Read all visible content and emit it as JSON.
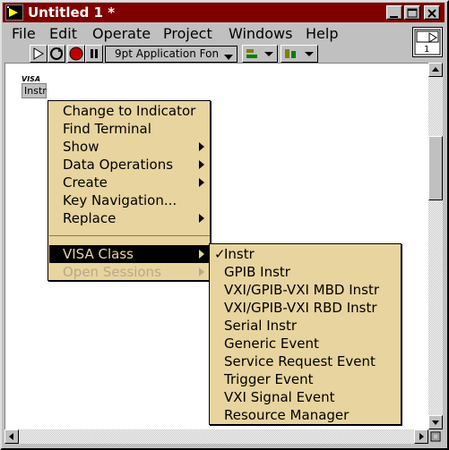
{
  "window": {
    "title": "Untitled 1 *"
  },
  "menubar": {
    "items": [
      {
        "label": "File"
      },
      {
        "label": "Edit"
      },
      {
        "label": "Operate"
      },
      {
        "label": "Project"
      },
      {
        "label": "Windows"
      },
      {
        "label": "Help"
      }
    ]
  },
  "toolbar": {
    "font": "9pt Application Fon"
  },
  "context_help": {
    "label": "1"
  },
  "control": {
    "tag": "VISA",
    "value": "Instr"
  },
  "context_menu": {
    "items": [
      {
        "label": "Change to Indicator",
        "submenu": false
      },
      {
        "label": "Find Terminal",
        "submenu": false
      },
      {
        "label": "Show",
        "submenu": true
      },
      {
        "label": "Data Operations",
        "submenu": true
      },
      {
        "label": "Create",
        "submenu": true
      },
      {
        "label": "Key Navigation...",
        "submenu": false
      },
      {
        "label": "Replace",
        "submenu": true
      }
    ],
    "visa_class": "VISA Class",
    "open_sessions": "Open Sessions"
  },
  "visa_submenu": {
    "items": [
      "Instr",
      "GPIB Instr",
      "VXI/GPIB-VXI MBD Instr",
      "VXI/GPIB-VXI RBD Instr",
      "Serial Instr",
      "Generic Event",
      "Service Request Event",
      "Trigger Event",
      "VXI Signal Event",
      "Resource Manager"
    ],
    "checked": "Instr",
    "checkmark": "✓"
  },
  "colors": {
    "title_bar": "#800000",
    "menu_bg": "#e8d49e",
    "selection": "#000000"
  }
}
